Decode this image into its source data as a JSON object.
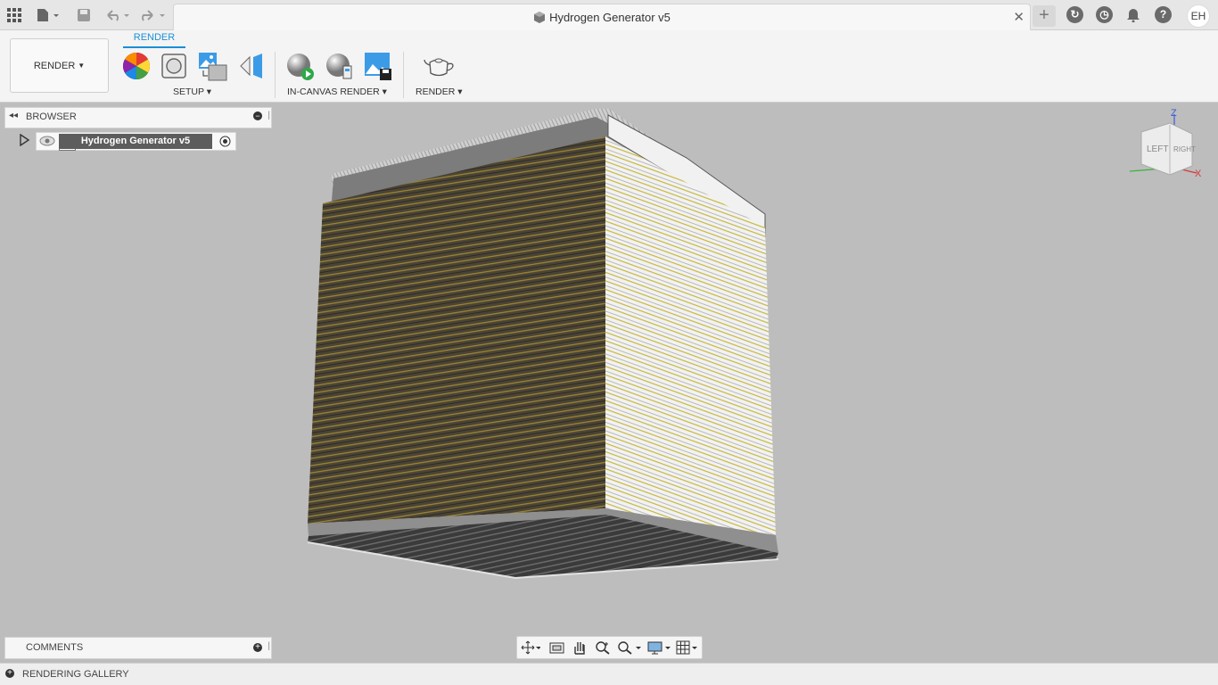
{
  "window": {
    "title": "Hydrogen Generator v5",
    "user_initials": "EH"
  },
  "toolbar": {
    "workspace_label": "RENDER",
    "active_tab": "RENDER",
    "groups": {
      "setup": "SETUP",
      "in_canvas": "IN-CANVAS RENDER",
      "render": "RENDER"
    }
  },
  "browser": {
    "label": "BROWSER",
    "root_node": "Hydrogen Generator v5"
  },
  "viewcube": {
    "left": "LEFT",
    "right": "RIGHT",
    "axis_z": "Z",
    "axis_x": "X"
  },
  "comments": {
    "label": "COMMENTS"
  },
  "gallery": {
    "label": "RENDERING GALLERY"
  },
  "colors": {
    "accent": "#1b8fd6",
    "canvas": "#bdbdbd"
  }
}
